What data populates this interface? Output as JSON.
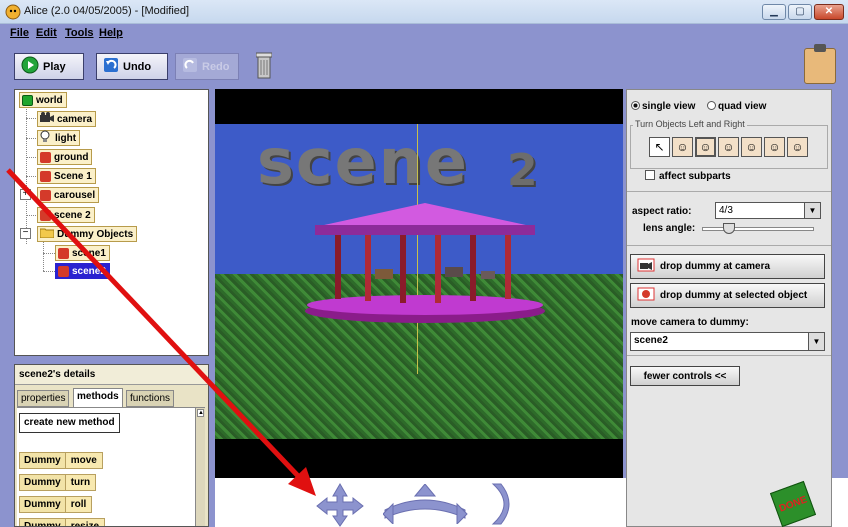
{
  "window": {
    "title": "Alice (2.0 04/05/2005) - [Modified]",
    "minimize": "▁",
    "maximize": "▢",
    "close": "✕"
  },
  "menubar": {
    "items": [
      {
        "label": "File"
      },
      {
        "label": "Edit"
      },
      {
        "label": "Tools"
      },
      {
        "label": "Help"
      }
    ]
  },
  "toolbar": {
    "play_label": "Play",
    "undo_label": "Undo",
    "redo_label": "Redo"
  },
  "object_tree": {
    "items": [
      {
        "label": "world",
        "color": "#1fa62d"
      },
      {
        "label": "camera",
        "color": "#333333"
      },
      {
        "label": "light",
        "color": "#ffffff"
      },
      {
        "label": "ground",
        "color": "#d43a2a"
      },
      {
        "label": "Scene 1",
        "color": "#d43a2a"
      },
      {
        "label": "carousel",
        "color": "#d43a2a"
      },
      {
        "label": "scene 2",
        "color": "#d43a2a"
      },
      {
        "label": "Dummy Objects",
        "color": "#f2c94c"
      },
      {
        "label": "scene1",
        "color": "#d43a2a"
      },
      {
        "label": "scene2",
        "color": "#d43a2a",
        "selected": true
      }
    ],
    "expand_carousel": "+",
    "expand_dummy": "−"
  },
  "details": {
    "title": "scene2's details",
    "tabs": [
      "properties",
      "methods",
      "functions"
    ],
    "active_tab": "methods",
    "create_method": "create new method",
    "methods": [
      {
        "object": "Dummy",
        "verb": "move"
      },
      {
        "object": "Dummy",
        "verb": "turn"
      },
      {
        "object": "Dummy",
        "verb": "roll"
      },
      {
        "object": "Dummy",
        "verb": "resize"
      }
    ]
  },
  "scene": {
    "title": "scene",
    "number": "2"
  },
  "camera_controls": {
    "single_view": "single view",
    "quad_view": "quad view",
    "view_mode": "single",
    "turn_legend": "Turn Objects Left and Right",
    "affect_subparts": "affect subparts",
    "aspect_ratio_label": "aspect ratio:",
    "aspect_ratio_value": "4/3",
    "lens_angle_label": "lens angle:",
    "drop_camera": "drop dummy at camera",
    "drop_object": "drop dummy at selected object",
    "move_camera_label": "move camera to dummy:",
    "move_camera_value": "scene2",
    "fewer_controls": "fewer controls <<"
  },
  "done_button": "DONE",
  "colors": {
    "workspace": "#8c93ce",
    "selection": "#2a22d0",
    "sky": "#3d5bc8",
    "arrow": "#e01010"
  }
}
